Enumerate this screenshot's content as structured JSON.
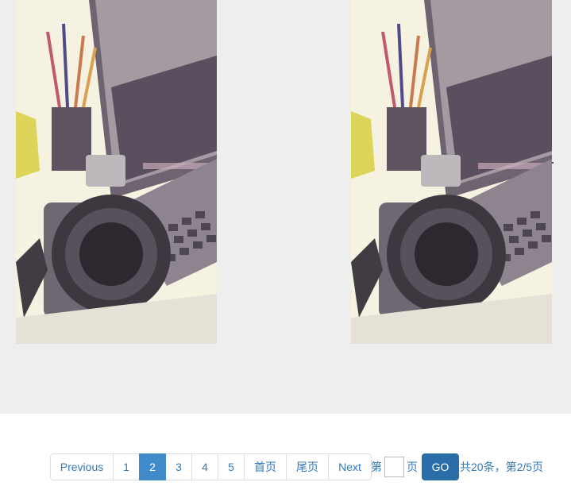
{
  "gallery": {
    "images": [
      {
        "icon": "camera-laptop-photo"
      },
      {
        "icon": "camera-laptop-photo"
      }
    ]
  },
  "pagination": {
    "previous_label": "Previous",
    "pages": [
      "1",
      "2",
      "3",
      "4",
      "5"
    ],
    "current_page": "2",
    "first_label": "首页",
    "last_label": "尾页",
    "next_label": "Next"
  },
  "jump": {
    "prefix": "第",
    "value": "",
    "suffix": "页",
    "go_label": "GO",
    "summary": "共20条，第2/5页"
  },
  "colors": {
    "accent": "#428bca",
    "go_button": "#2b6da8",
    "link": "#337ab7",
    "gallery_background": "#eeeeee"
  }
}
